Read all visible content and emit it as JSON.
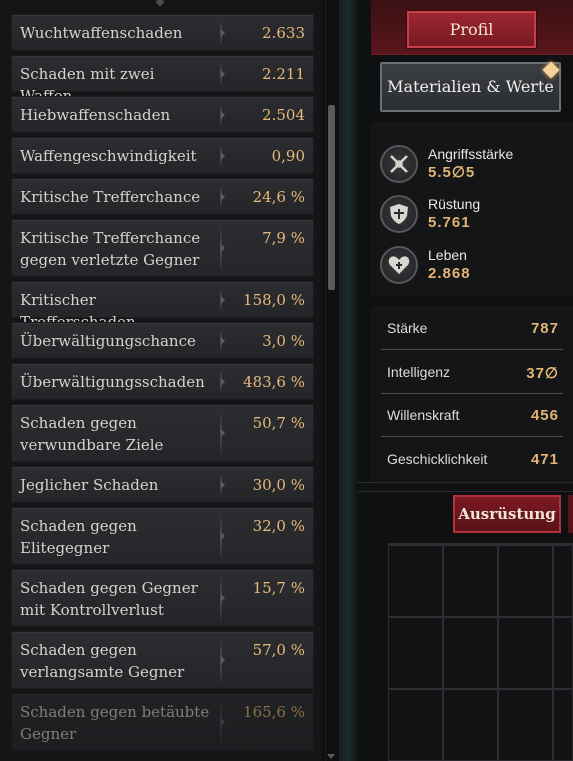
{
  "stats": [
    {
      "label": "Wuchtwaffenschaden",
      "value": "2.633"
    },
    {
      "label": "Schaden mit zwei Waffen",
      "value": "2.211"
    },
    {
      "label": "Hiebwaffenschaden",
      "value": "2.504"
    },
    {
      "label": "Waffengeschwindigkeit",
      "value": "0,90"
    },
    {
      "label": "Kritische Trefferchance",
      "value": "24,6 %"
    },
    {
      "label": "Kritische Trefferchance gegen verletzte Gegner",
      "value": "7,9 %"
    },
    {
      "label": "Kritischer Trefferschaden",
      "value": "158,0 %"
    },
    {
      "label": "Überwältigungschance",
      "value": "3,0 %"
    },
    {
      "label": "Überwältigungsschaden",
      "value": "483,6 %"
    },
    {
      "label": "Schaden gegen verwundbare Ziele",
      "value": "50,7 %"
    },
    {
      "label": "Jeglicher Schaden",
      "value": "30,0 %"
    },
    {
      "label": "Schaden gegen Elitegegner",
      "value": "32,0 %"
    },
    {
      "label": "Schaden gegen Gegner mit Kontrollverlust",
      "value": "15,7 %"
    },
    {
      "label": "Schaden gegen verlangsamte Gegner",
      "value": "57,0 %"
    },
    {
      "label": "Schaden gegen betäubte Gegner",
      "value": "165,6 %"
    }
  ],
  "tabs": {
    "profile": "Profil",
    "equipment": "Ausrüstung"
  },
  "materials_button": "Materialien & Werte",
  "attributes": [
    {
      "name": "Angriffsstärke",
      "value": "5.5∅5",
      "icon": "crossed-swords-icon"
    },
    {
      "name": "Rüstung",
      "value": "5.761",
      "icon": "shield-icon"
    },
    {
      "name": "Leben",
      "value": "2.868",
      "icon": "heart-icon"
    }
  ],
  "core_stats": [
    {
      "name": "Stärke",
      "value": "787"
    },
    {
      "name": "Intelligenz",
      "value": "37∅"
    },
    {
      "name": "Willenskraft",
      "value": "456"
    },
    {
      "name": "Geschicklichkeit",
      "value": "471"
    }
  ],
  "colors": {
    "value_gold": "#e5b97a",
    "accent_red": "#9b2630"
  }
}
